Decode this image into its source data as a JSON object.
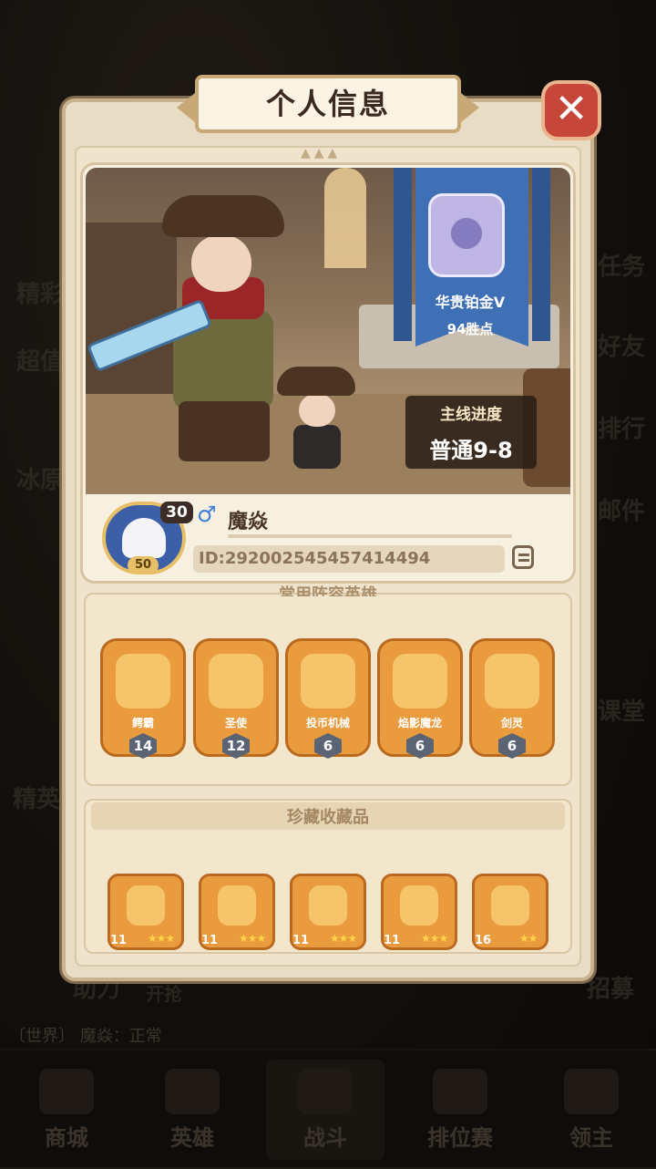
{
  "background": {
    "labels": [
      "精彩",
      "超值",
      "冰原",
      "任务",
      "好友",
      "排行",
      "邮件",
      "课堂",
      "招募",
      "精英",
      "助力",
      "开抢"
    ],
    "chat_text": "〔世界〕 魔焱：正常",
    "nav_tabs": [
      {
        "label": "商城"
      },
      {
        "label": "英雄"
      },
      {
        "label": "战斗"
      },
      {
        "label": "排位赛"
      },
      {
        "label": "领主"
      }
    ]
  },
  "dialog": {
    "title": "个人信息",
    "close_label": "✕"
  },
  "profile": {
    "rank_name": "华贵铂金V",
    "rank_wins": "94胜点",
    "progress_label": "主线进度",
    "progress_value": "普通9-8",
    "avatar_level": "50",
    "level": "30",
    "gender_symbol": "♂",
    "name": "魔焱",
    "id": "ID:292002545457414494"
  },
  "heroes": {
    "title": "常用阵容英雄",
    "items": [
      {
        "name": "鳄霸",
        "level": "14"
      },
      {
        "name": "圣使",
        "level": "12"
      },
      {
        "name": "投币机械",
        "level": "6"
      },
      {
        "name": "焰影魔龙",
        "level": "6"
      },
      {
        "name": "剑灵",
        "level": "6"
      }
    ]
  },
  "collection": {
    "title": "珍藏收藏品",
    "items": [
      {
        "count": "11",
        "stars": "★★★"
      },
      {
        "count": "11",
        "stars": "★★★"
      },
      {
        "count": "11",
        "stars": "★★★"
      },
      {
        "count": "11",
        "stars": "★★★"
      },
      {
        "count": "16",
        "stars": "★★"
      }
    ]
  },
  "colors": {
    "panel": "#e9dcc4",
    "item_orange": "#e99b3d",
    "rank_banner": "#3f6fb5",
    "close_red": "#c6463a"
  }
}
